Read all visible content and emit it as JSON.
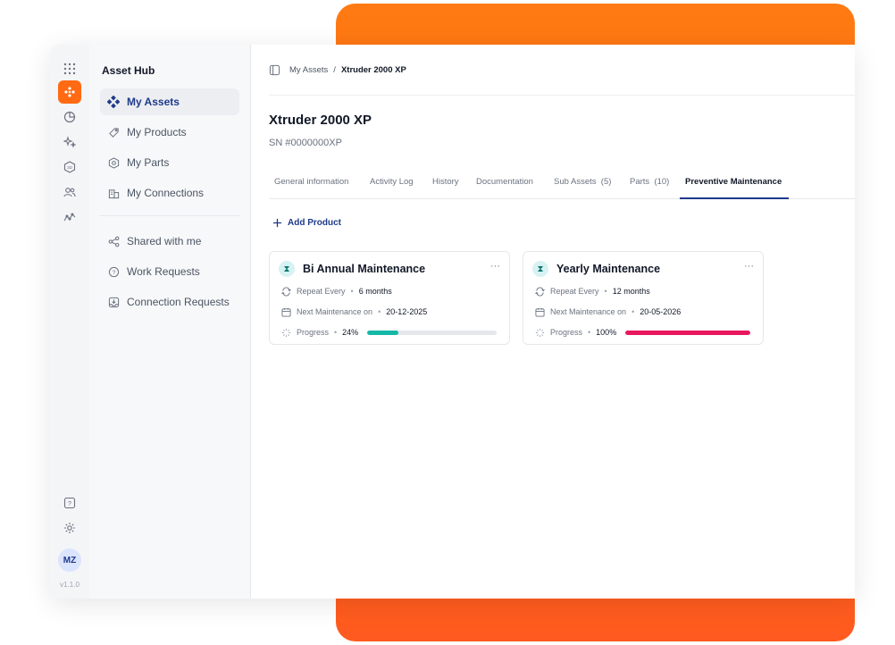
{
  "app": {
    "sidebar_title": "Asset Hub",
    "version": "v1.1.0",
    "user_initials": "MZ"
  },
  "rail_icons": [
    "apps-grid-icon",
    "asset-hub-icon",
    "pie-chart-icon",
    "sparkles-icon",
    "3d-icon",
    "users-icon",
    "analytics-icon",
    "help-icon",
    "settings-icon"
  ],
  "sidebar": {
    "primary": [
      {
        "label": "My Assets",
        "icon": "diamond-cluster-icon",
        "active": true
      },
      {
        "label": "My Products",
        "icon": "tag-icon"
      },
      {
        "label": "My Parts",
        "icon": "hexagon-icon"
      },
      {
        "label": "My Connections",
        "icon": "building-icon"
      }
    ],
    "secondary": [
      {
        "label": "Shared with me",
        "icon": "share-icon"
      },
      {
        "label": "Work Requests",
        "icon": "question-circle-icon"
      },
      {
        "label": "Connection Requests",
        "icon": "inbox-icon"
      }
    ]
  },
  "breadcrumb": {
    "parent": "My Assets",
    "separator": "/",
    "current": "Xtruder 2000 XP"
  },
  "asset": {
    "title": "Xtruder 2000 XP",
    "serial": "SN #0000000XP"
  },
  "tabs": [
    {
      "label": "General information"
    },
    {
      "label": "Activity Log"
    },
    {
      "label": "History"
    },
    {
      "label": "Documentation"
    },
    {
      "label": "Sub Assets  (5)"
    },
    {
      "label": "Parts  (10)"
    },
    {
      "label": "Preventive Maintenance",
      "active": true
    }
  ],
  "actions": {
    "add_product": "Add Product"
  },
  "cards": [
    {
      "title": "Bi Annual Maintenance",
      "repeat_label": "Repeat Every",
      "repeat_value": "6 months",
      "next_label": "Next Maintenance on",
      "next_value": "20-12-2025",
      "progress_label": "Progress",
      "progress_value": "24%",
      "progress": 0.24,
      "color": "#14b8a6"
    },
    {
      "title": "Yearly Maintenance",
      "repeat_label": "Repeat Every",
      "repeat_value": "12 months",
      "next_label": "Next Maintenance on",
      "next_value": "20-05-2026",
      "progress_label": "Progress",
      "progress_value": "100%",
      "progress": 1.0,
      "color": "#e8175d"
    }
  ],
  "colors": {
    "accent": "#ff6a13",
    "brand": "#1e3a8a"
  }
}
